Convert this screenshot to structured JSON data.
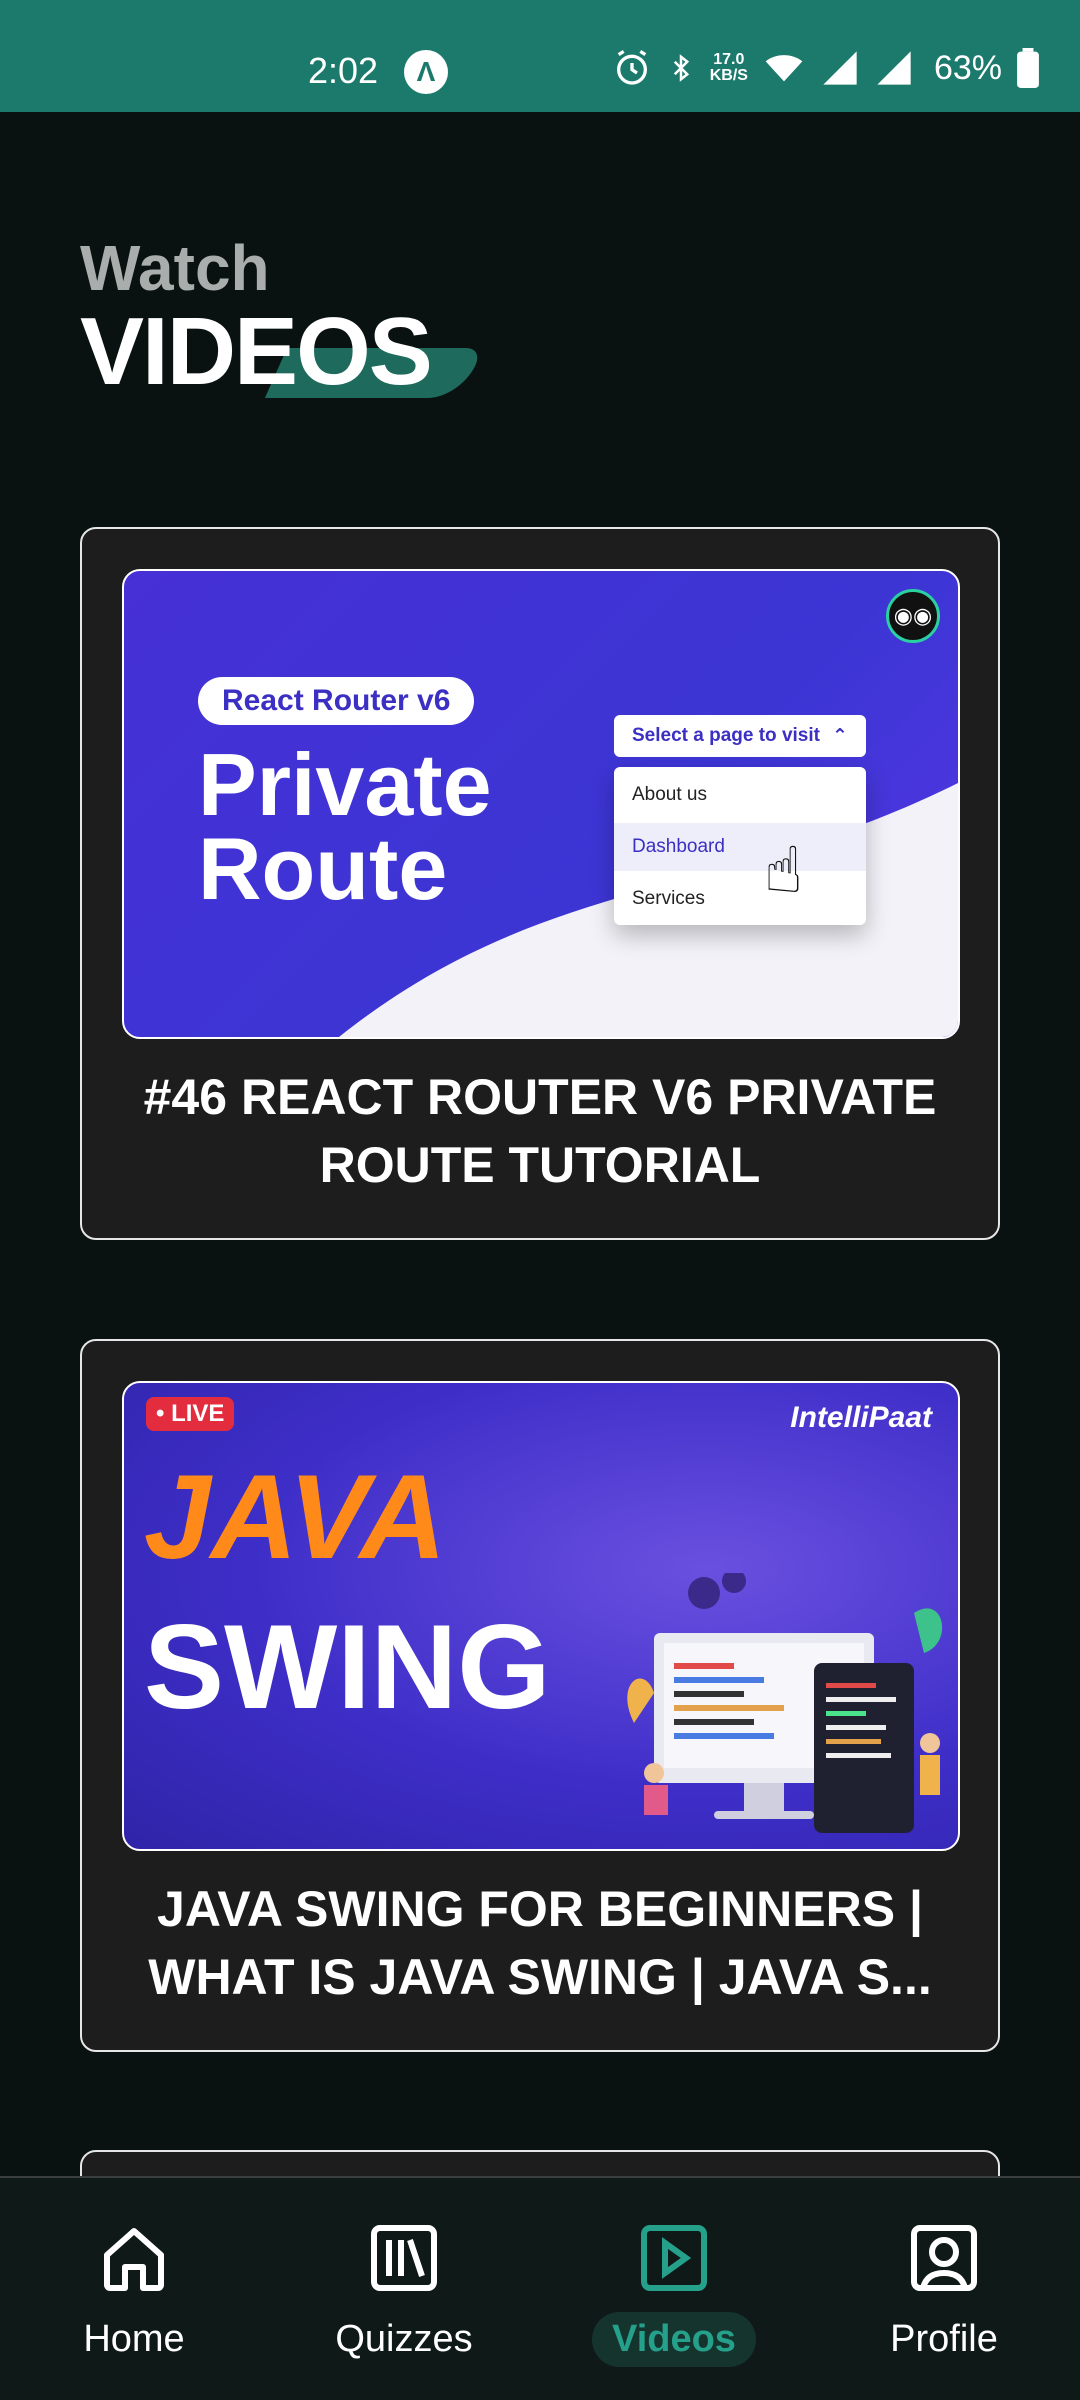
{
  "status_bar": {
    "time": "2:02",
    "app_glyph": "Λ",
    "net_speed_value": "17.0",
    "net_speed_unit": "KB/S",
    "battery": "63%"
  },
  "heading": {
    "subtitle": "Watch",
    "title": "VIDEOS"
  },
  "videos": [
    {
      "title": "#46 REACT ROUTER V6 PRIVATE ROUTE TUTORIAL",
      "thumbnail": {
        "pill": "React Router v6",
        "line1": "Private",
        "line2": "Route",
        "select_label": "Select a page to visit",
        "menu": [
          "About us",
          "Dashboard",
          "Services"
        ]
      }
    },
    {
      "title": "JAVA SWING FOR BEGINNERS | WHAT IS JAVA SWING | JAVA S...",
      "thumbnail": {
        "live": "• LIVE",
        "brand": "IntelliPaat",
        "line1": "JAVA",
        "line2": "SWING"
      }
    }
  ],
  "nav": {
    "items": [
      {
        "label": "Home",
        "icon": "home-icon"
      },
      {
        "label": "Quizzes",
        "icon": "library-icon"
      },
      {
        "label": "Videos",
        "icon": "play-square-icon",
        "active": true
      },
      {
        "label": "Profile",
        "icon": "profile-icon"
      }
    ]
  },
  "colors": {
    "background": "#091210",
    "status_bar": "#1b7a6c",
    "accent": "#25a08a",
    "card": "#1d1d1d"
  }
}
